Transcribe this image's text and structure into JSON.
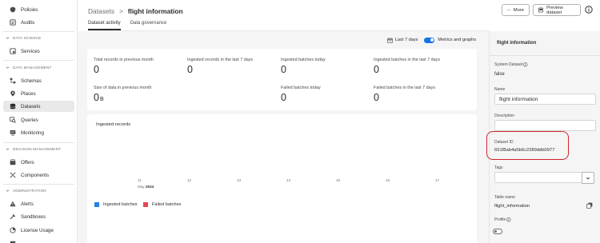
{
  "nav": {
    "policies": "Policies",
    "audits": "Audits",
    "section_data_science": "DATA SCIENCE",
    "services": "Services",
    "section_data_management": "DATA MANAGEMENT",
    "schemas": "Schemas",
    "places": "Places",
    "datasets": "Datasets",
    "queries": "Queries",
    "monitoring": "Monitoring",
    "section_decision_management": "DECISION MANAGEMENT",
    "offers": "Offers",
    "components": "Components",
    "section_administration": "ADMINISTRATION",
    "alerts": "Alerts",
    "sandboxes": "Sandboxes",
    "license_usage": "License Usage",
    "active_item": "Datasets"
  },
  "header": {
    "breadcrumb_parent": "Datasets",
    "breadcrumb_separator": ">",
    "breadcrumb_current": "flight information",
    "more_label": "More",
    "preview_label": "Preview dataset"
  },
  "tabs": {
    "activity": "Dataset activity",
    "governance": "Data governance",
    "active": "Dataset activity"
  },
  "filters": {
    "date_range": "Last 7 days",
    "metrics_toggle_label": "Metrics and graphs",
    "metrics_toggle_on": true
  },
  "metrics": {
    "total_records_label": "Total records in previous month",
    "total_records_value": "0",
    "ingested_records_label": "Ingested records in the last 7 days",
    "ingested_records_value": "0",
    "ingested_batches_today_label": "Ingested batches today",
    "ingested_batches_today_value": "0",
    "ingested_batches_7d_label": "Ingested batches in the last 7 days",
    "ingested_batches_7d_value": "0",
    "size_label": "Size of data in previous month",
    "size_value": "0",
    "size_unit": "B",
    "failed_today_label": "Failed batches today",
    "failed_today_value": "0",
    "failed_7d_label": "Failed batches in the last 7 days",
    "failed_7d_value": "0"
  },
  "chart": {
    "title": "Ingested records",
    "month_label": "May",
    "year_label": "2024",
    "legend_ingested": "Ingested batches",
    "legend_failed": "Failed batches",
    "color_ingested": "#2680eb",
    "color_failed": "#e34850"
  },
  "chart_data": {
    "type": "bar",
    "title": "Ingested records",
    "categories": [
      "11",
      "12",
      "13",
      "14",
      "15",
      "16",
      "17"
    ],
    "series": [
      {
        "name": "Ingested batches",
        "values": [
          0,
          0,
          0,
          0,
          0,
          0,
          0
        ]
      },
      {
        "name": "Failed batches",
        "values": [
          0,
          0,
          0,
          0,
          0,
          0,
          0
        ]
      }
    ],
    "legend": "bottom-left",
    "grid": false
  },
  "panel": {
    "title": "flight information",
    "system_dataset_label": "System Dataset",
    "system_dataset_value": "false",
    "name_label": "Name",
    "name_value": "flight information",
    "description_label": "Description",
    "description_value": "",
    "dataset_id_label": "Dataset ID",
    "dataset_id_value": "651f8ab4a5b6c2289ddb0977",
    "tags_label": "Tags",
    "tags_value": "",
    "table_name_label": "Table name",
    "table_name_value": "flight_information",
    "profile_label": "Profile",
    "profile_on": false
  },
  "colors": {
    "accent": "#1473e6",
    "highlight": "#d0222f"
  }
}
